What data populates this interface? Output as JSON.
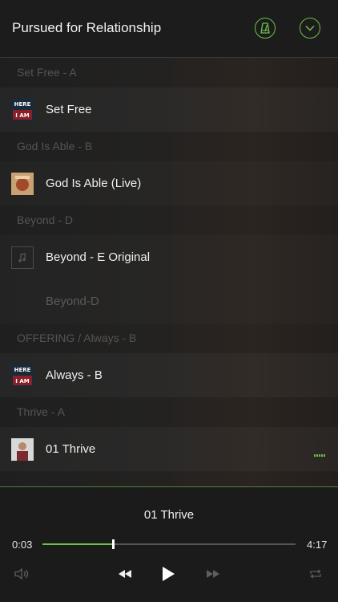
{
  "header": {
    "title": "Pursued for Relationship",
    "metronome_icon": "metronome-icon",
    "collapse_icon": "chevron-down-icon",
    "accent": "#6cc04a"
  },
  "sections": [
    {
      "title": "Set Free - A",
      "items": [
        {
          "label": "Set Free",
          "thumb": "here-i-am-album-art"
        }
      ]
    },
    {
      "title": "God Is Able - B",
      "items": [
        {
          "label": "God Is Able (Live)",
          "thumb": "god-is-able-album-art"
        }
      ]
    },
    {
      "title": "Beyond - D",
      "items": [
        {
          "label": "Beyond - E Original",
          "thumb": "music-note-icon"
        },
        {
          "label": "Beyond-D",
          "thumb": ""
        }
      ]
    },
    {
      "title": "OFFERING / Always - B",
      "items": [
        {
          "label": "Always - B",
          "thumb": "here-i-am-album-art"
        }
      ]
    },
    {
      "title": "Thrive - A",
      "items": [
        {
          "label": "01 Thrive",
          "thumb": "thrive-album-art",
          "playing": true
        }
      ]
    }
  ],
  "player": {
    "now_playing": "01 Thrive",
    "elapsed": "0:03",
    "duration": "4:17",
    "progress_fraction": 0.28,
    "icons": [
      "volume-icon",
      "rewind-icon",
      "play-icon",
      "fast-forward-icon",
      "repeat-icon"
    ]
  }
}
